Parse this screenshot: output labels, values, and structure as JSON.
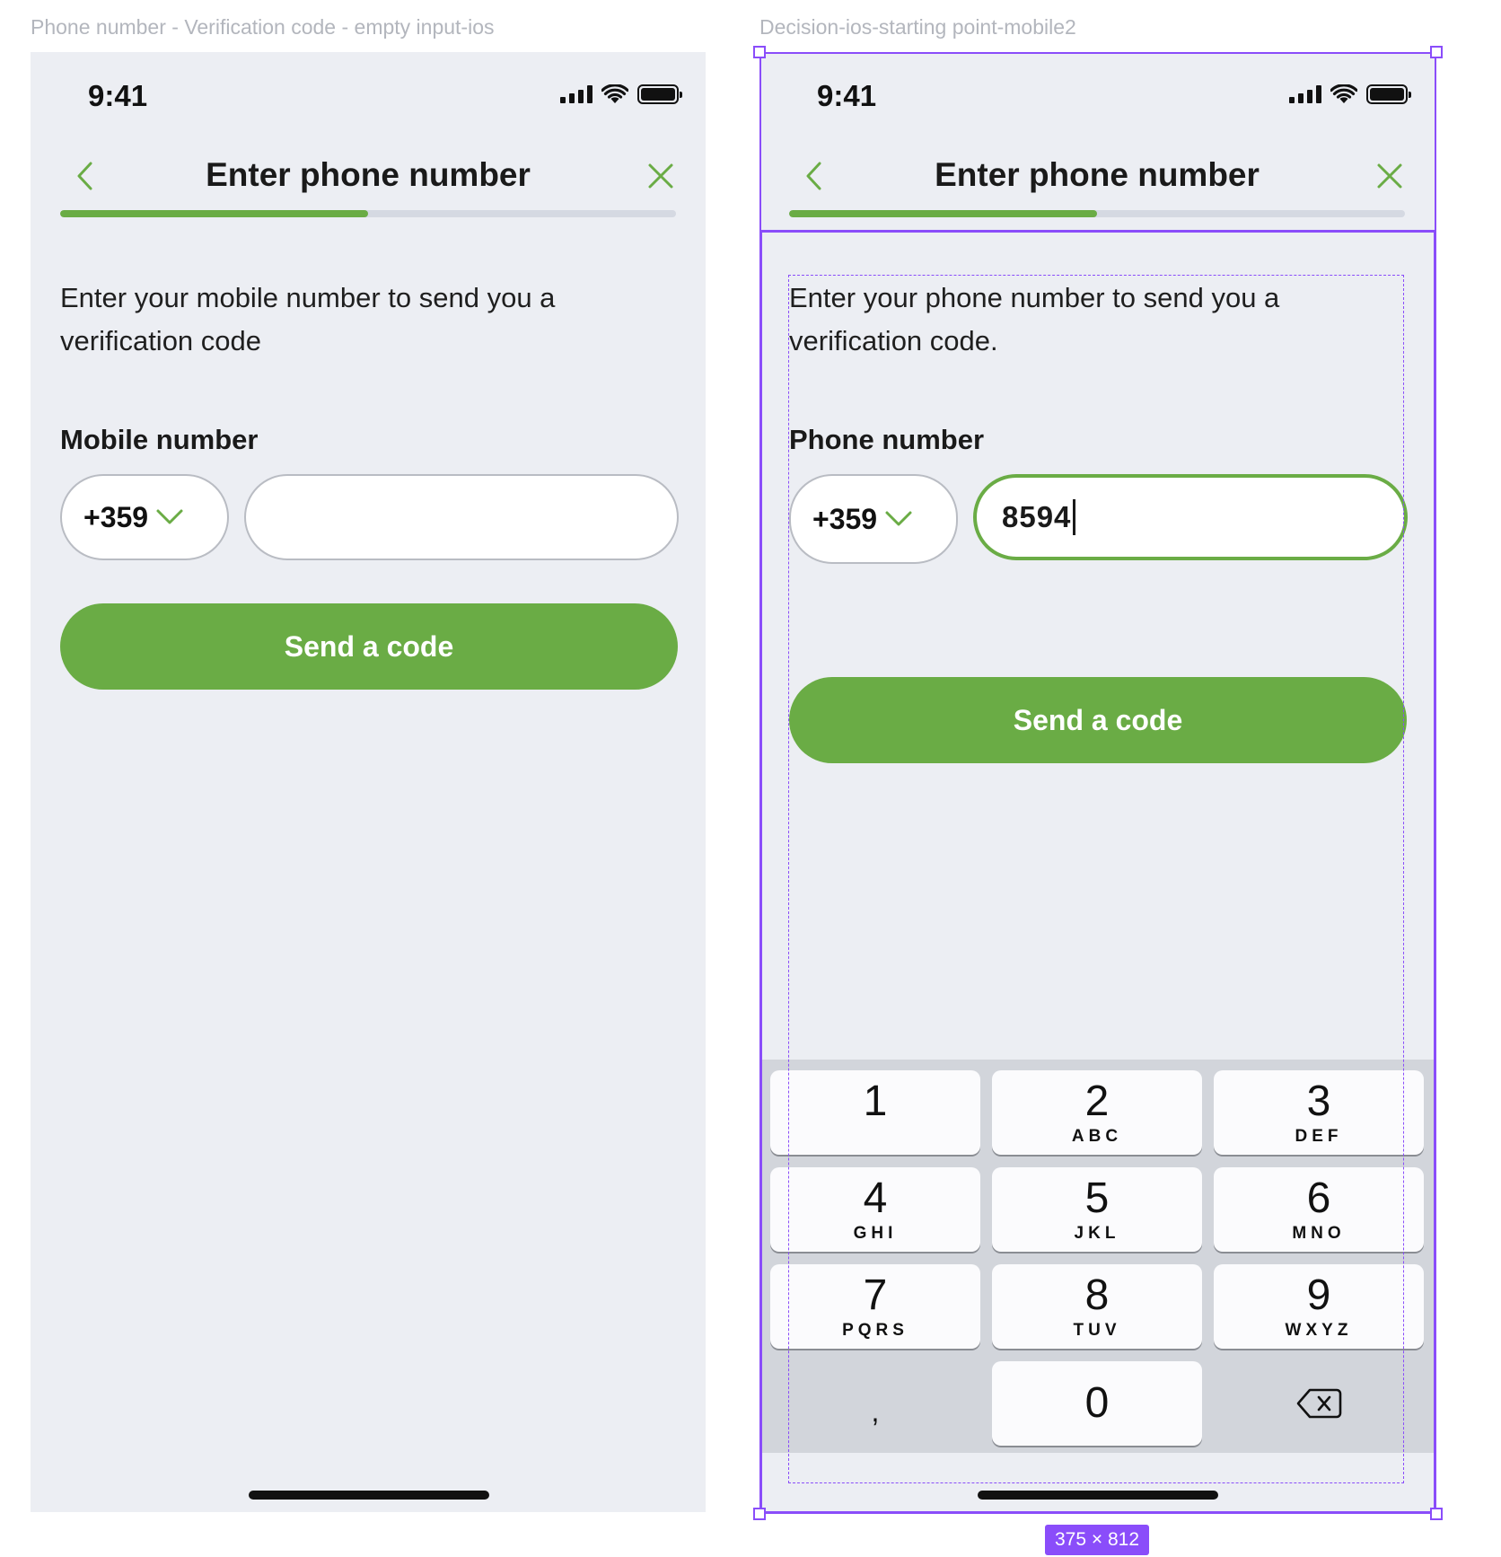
{
  "frames": [
    {
      "frame_label": "Phone number - Verification code - empty input-ios",
      "status": {
        "time": "9:41"
      },
      "header": {
        "title": "Enter phone number",
        "back_icon": "chevron-left-icon",
        "close_icon": "close-icon",
        "progress": 0.5
      },
      "description": "Enter your mobile number to send you a verification code",
      "field_label": "Mobile number",
      "country_code": "+359",
      "phone_value": "",
      "button_label": "Send a code"
    },
    {
      "frame_label": "Decision-ios-starting point-mobile2",
      "status": {
        "time": "9:41"
      },
      "header": {
        "title": "Enter phone number",
        "back_icon": "chevron-left-icon",
        "close_icon": "close-icon",
        "progress": 0.5
      },
      "description": "Enter your phone number to send you a verification code.",
      "field_label": "Phone number",
      "country_code": "+359",
      "phone_value": "8594",
      "button_label": "Send a code",
      "keypad": {
        "keys": [
          {
            "num": "1",
            "letters": ""
          },
          {
            "num": "2",
            "letters": "ABC"
          },
          {
            "num": "3",
            "letters": "DEF"
          },
          {
            "num": "4",
            "letters": "GHI"
          },
          {
            "num": "5",
            "letters": "JKL"
          },
          {
            "num": "6",
            "letters": "MNO"
          },
          {
            "num": "7",
            "letters": "PQRS"
          },
          {
            "num": "8",
            "letters": "TUV"
          },
          {
            "num": "9",
            "letters": "WXYZ"
          }
        ],
        "comma": ",",
        "zero": "0",
        "delete_icon": "backspace-icon"
      },
      "size_badge": "375 × 812"
    }
  ],
  "colors": {
    "accent": "#6aac45",
    "background": "#eceef3",
    "selection": "#8a4dfa"
  }
}
